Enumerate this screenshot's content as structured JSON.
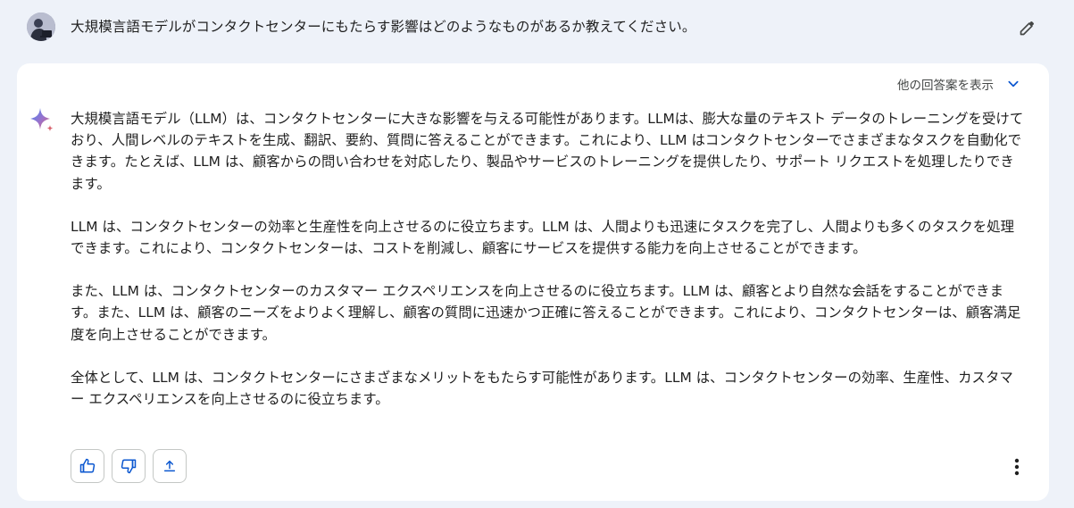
{
  "prompt": {
    "text": "大規模言語モデルがコンタクトセンターにもたらす影響はどのようなものがあるか教えてください。",
    "edit_icon": "pencil-icon"
  },
  "response": {
    "drafts_label": "他の回答案を表示",
    "drafts_icon": "chevron-down-icon",
    "model_icon": "sparkle-icon",
    "paragraphs": [
      "大規模言語モデル（LLM）は、コンタクトセンターに大きな影響を与える可能性があります。LLMは、膨大な量のテキスト データのトレーニングを受けており、人間レベルのテキストを生成、翻訳、要約、質問に答えることができます。これにより、LLM はコンタクトセンターでさまざまなタスクを自動化できます。たとえば、LLM は、顧客からの問い合わせを対応したり、製品やサービスのトレーニングを提供したり、サポート リクエストを処理したりできます。",
      "LLM は、コンタクトセンターの効率と生産性を向上させるのに役立ちます。LLM は、人間よりも迅速にタスクを完了し、人間よりも多くのタスクを処理できます。これにより、コンタクトセンターは、コストを削減し、顧客にサービスを提供する能力を向上させることができます。",
      "また、LLM は、コンタクトセンターのカスタマー エクスペリエンスを向上させるのに役立ちます。LLM は、顧客とより自然な会話をすることができます。また、LLM は、顧客のニーズをよりよく理解し、顧客の質問に迅速かつ正確に答えることができます。これにより、コンタクトセンターは、顧客満足度を向上させることができます。",
      "全体として、LLM は、コンタクトセンターにさまざまなメリットをもたらす可能性があります。LLM は、コンタクトセンターの効率、生産性、カスタマー エクスペリエンスを向上させるのに役立ちます。"
    ]
  },
  "actions": {
    "icons": [
      "thumbs-up-icon",
      "thumbs-down-icon",
      "share-icon",
      "more-vert-icon"
    ]
  },
  "colors": {
    "page_background": "#eef2f9",
    "card_background": "#ffffff",
    "text": "#1f1f1f",
    "accent_blue": "#0b57d0",
    "icon_gray": "#444746"
  }
}
